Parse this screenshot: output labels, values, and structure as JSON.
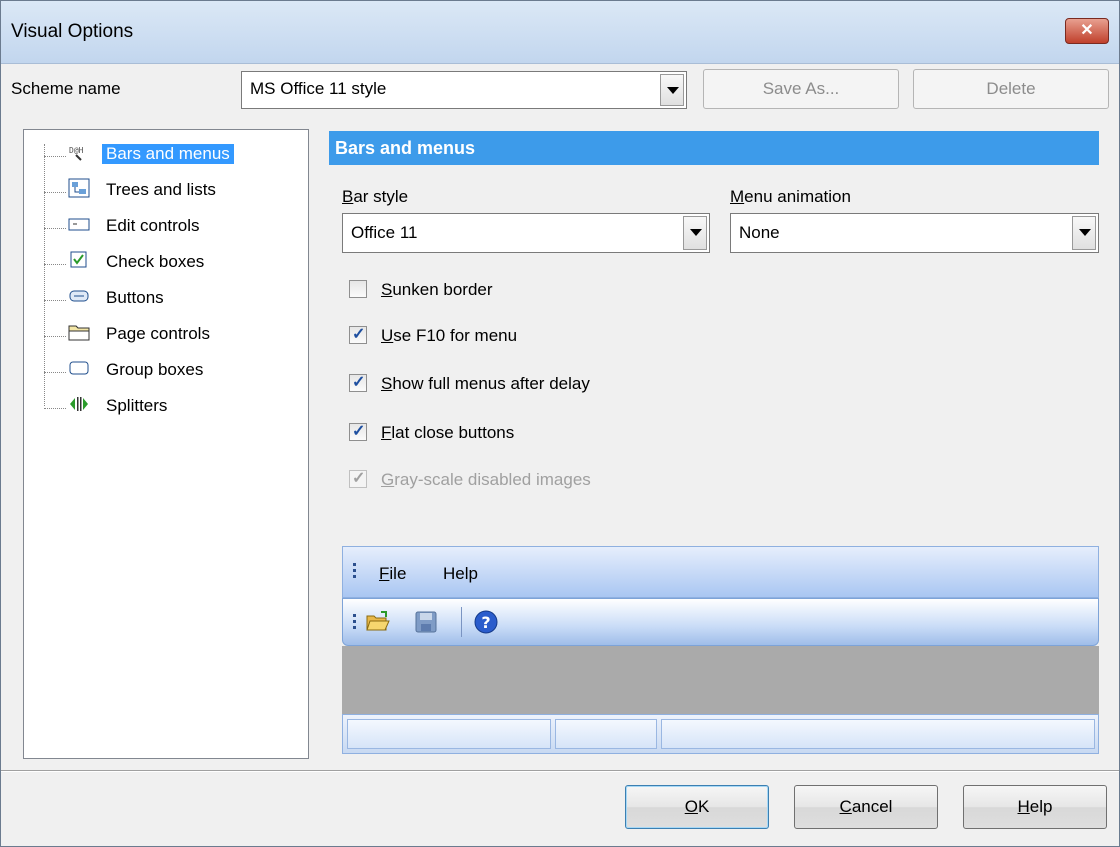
{
  "window": {
    "title": "Visual Options",
    "close_label": "✕"
  },
  "scheme": {
    "label": "Scheme name",
    "value": "MS Office 11 style",
    "save_as": "Save As...",
    "delete": "Delete"
  },
  "tree": {
    "items": [
      {
        "label": "Bars and menus",
        "icon": "bars-menus-icon",
        "selected": true
      },
      {
        "label": "Trees and lists",
        "icon": "trees-lists-icon"
      },
      {
        "label": "Edit controls",
        "icon": "edit-controls-icon"
      },
      {
        "label": "Check boxes",
        "icon": "check-boxes-icon"
      },
      {
        "label": "Buttons",
        "icon": "buttons-icon"
      },
      {
        "label": "Page controls",
        "icon": "page-controls-icon"
      },
      {
        "label": "Group boxes",
        "icon": "group-boxes-icon"
      },
      {
        "label": "Splitters",
        "icon": "splitters-icon"
      }
    ]
  },
  "panel": {
    "title": "Bars and menus",
    "bar_style": {
      "label_key": "B",
      "label_rest": "ar style",
      "value": "Office 11"
    },
    "menu_animation": {
      "label_key": "M",
      "label_rest": "enu animation",
      "value": "None"
    },
    "checkboxes": [
      {
        "key": "S",
        "rest": "unken border",
        "checked": false,
        "disabled": false
      },
      {
        "key": "U",
        "rest": "se F10 for menu",
        "checked": true,
        "disabled": false
      },
      {
        "key": "S",
        "rest": "how full menus after delay",
        "checked": true,
        "disabled": false
      },
      {
        "key": "F",
        "rest": "lat close buttons",
        "checked": true,
        "disabled": false
      },
      {
        "key": "G",
        "rest": "ray-scale disabled images",
        "checked": true,
        "disabled": true
      }
    ],
    "preview": {
      "menu_file_key": "F",
      "menu_file_rest": "ile",
      "menu_help": "Help"
    }
  },
  "footer": {
    "ok_key": "O",
    "ok_rest": "K",
    "cancel_key": "C",
    "cancel_rest": "ancel",
    "help_key": "H",
    "help_rest": "elp"
  },
  "colors": {
    "selection": "#3399ff",
    "panel_header": "#3d9bea"
  }
}
